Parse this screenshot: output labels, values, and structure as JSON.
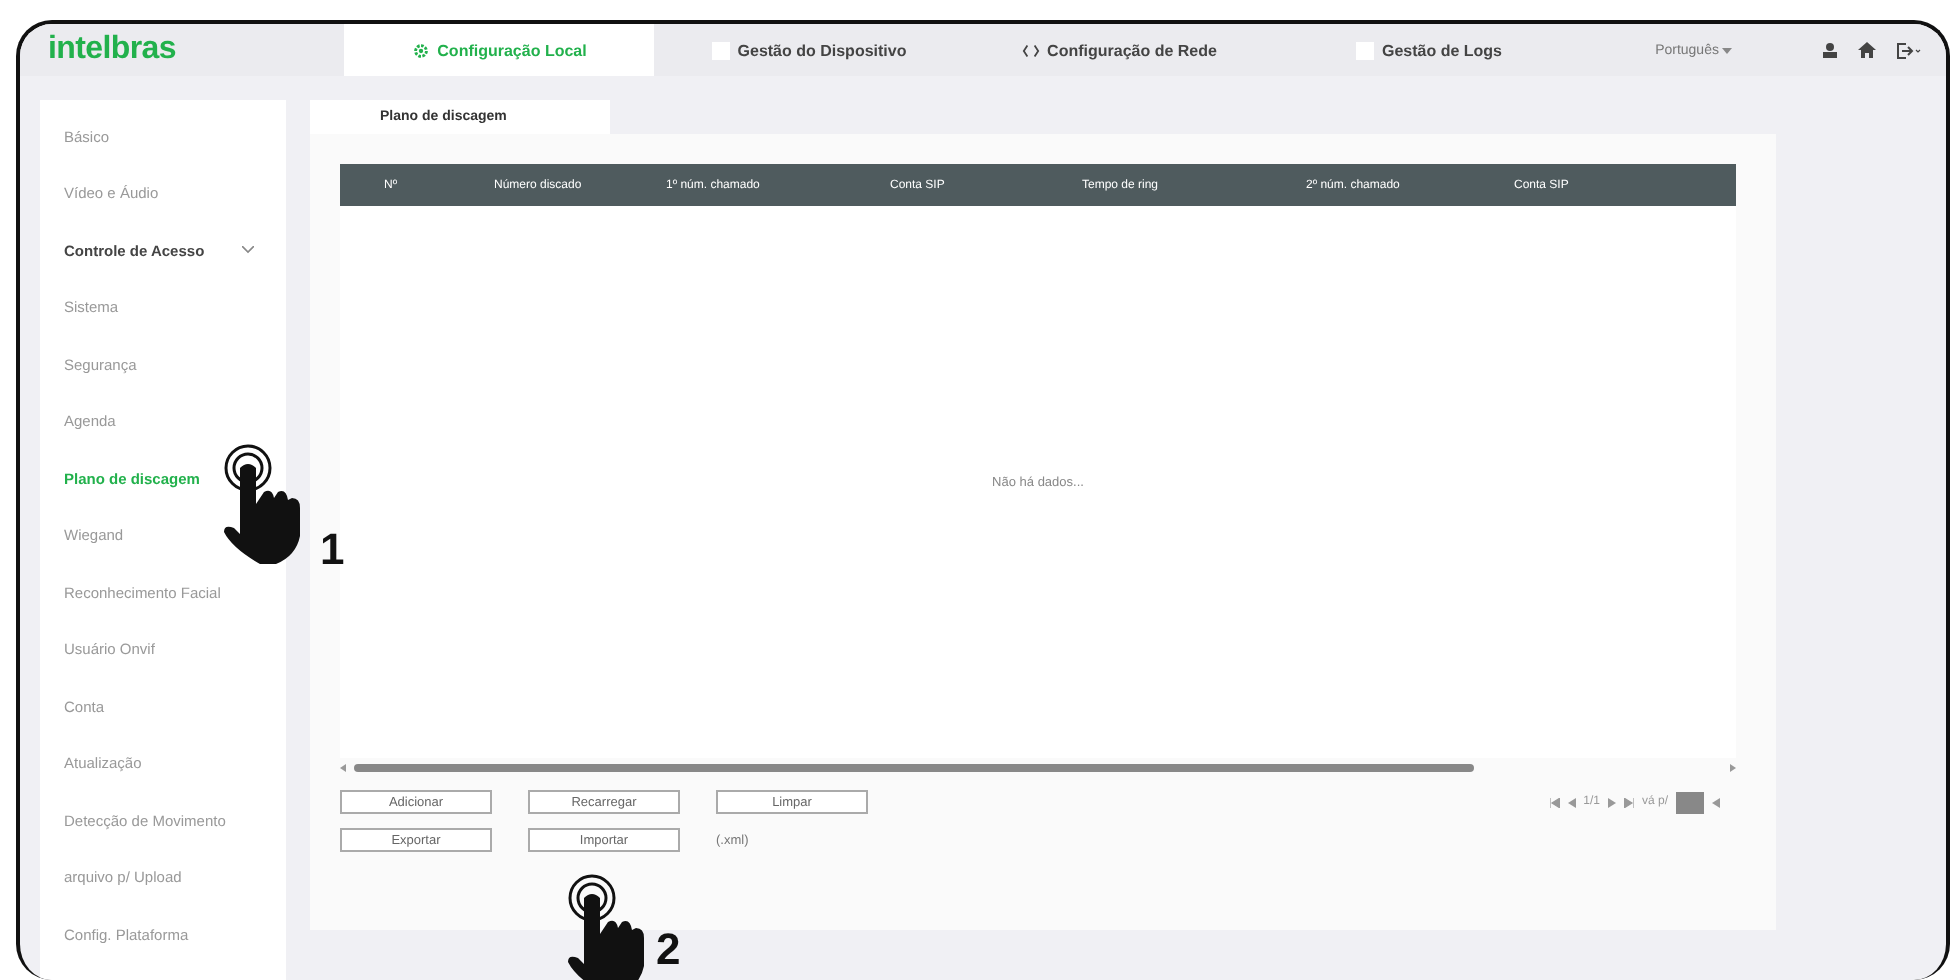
{
  "header": {
    "logo": "intelbras",
    "tabs": [
      {
        "label": "Configuração Local",
        "selected": true,
        "kind": "gear"
      },
      {
        "label": "Gestão do Dispositivo",
        "selected": false,
        "kind": "blank"
      },
      {
        "label": "Configuração de Rede",
        "selected": false,
        "kind": "network"
      },
      {
        "label": "Gestão de Logs",
        "selected": false,
        "kind": "blank"
      }
    ],
    "language": "Português"
  },
  "sidebar": {
    "items": [
      {
        "label": "Básico",
        "selected": false,
        "kind": "item"
      },
      {
        "label": "Vídeo e Áudio",
        "selected": false,
        "kind": "item"
      },
      {
        "label": "Controle de Acesso",
        "selected": false,
        "kind": "group",
        "expanded": true
      },
      {
        "label": "Sistema",
        "selected": false,
        "kind": "item"
      },
      {
        "label": "Segurança",
        "selected": false,
        "kind": "item"
      },
      {
        "label": "Agenda",
        "selected": false,
        "kind": "item"
      },
      {
        "label": "Plano de discagem",
        "selected": true,
        "kind": "item"
      },
      {
        "label": "Wiegand",
        "selected": false,
        "kind": "item"
      },
      {
        "label": "Reconhecimento Facial",
        "selected": false,
        "kind": "item"
      },
      {
        "label": "Usuário Onvif",
        "selected": false,
        "kind": "item"
      },
      {
        "label": "Conta",
        "selected": false,
        "kind": "item"
      },
      {
        "label": "Atualização",
        "selected": false,
        "kind": "item"
      },
      {
        "label": "Detecção de Movimento",
        "selected": false,
        "kind": "item"
      },
      {
        "label": "arquivo p/ Upload",
        "selected": false,
        "kind": "item"
      },
      {
        "label": "Config. Plataforma",
        "selected": false,
        "kind": "item"
      }
    ]
  },
  "page_tab": {
    "label": "Plano de discagem"
  },
  "table": {
    "columns": [
      "Nº",
      "Número discado",
      "1º núm. chamado",
      "Conta SIP",
      "Tempo de ring",
      "2º núm. chamado",
      "Conta SIP"
    ],
    "empty_text": "Não há dados..."
  },
  "buttons": [
    [
      "Adicionar",
      "Recarregar",
      "Limpar"
    ],
    [
      "Exportar",
      "Importar"
    ]
  ],
  "file_hint": "(.xml)",
  "pager": {
    "page": "1/1",
    "goto": "vá p/"
  },
  "annotations": [
    {
      "number": "1"
    },
    {
      "number": "2"
    }
  ]
}
